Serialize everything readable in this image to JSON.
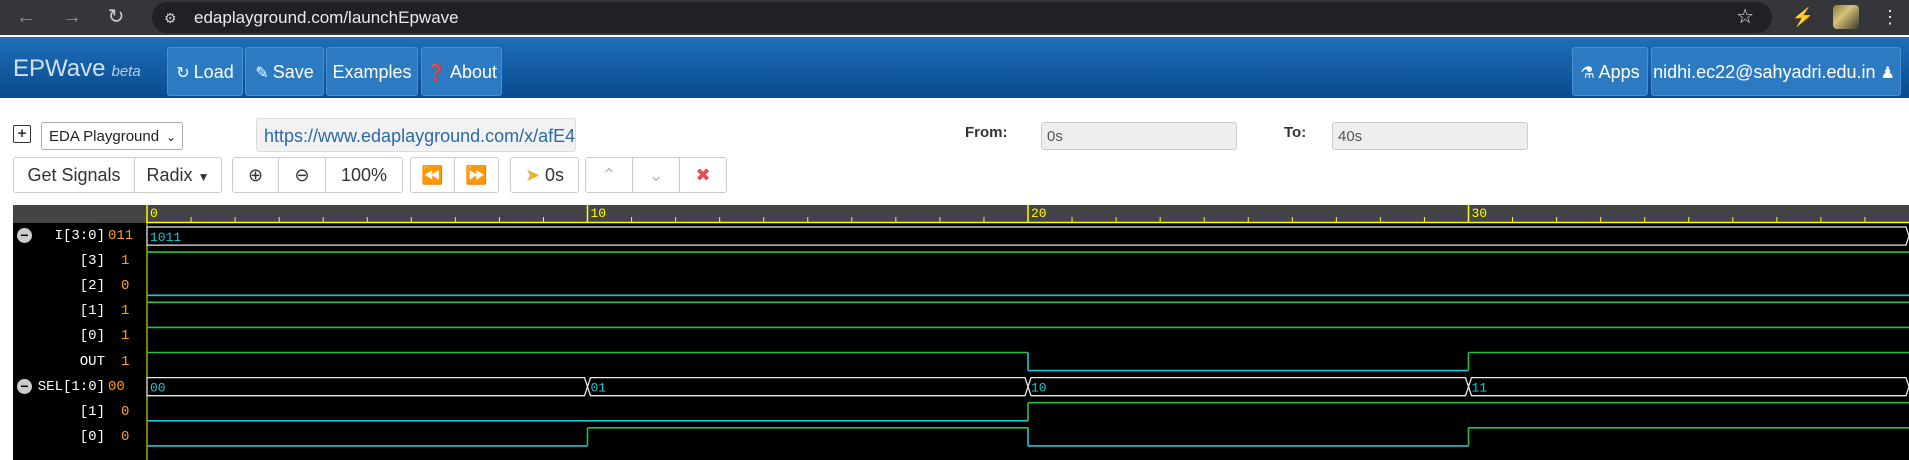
{
  "browser": {
    "url": "edaplayground.com/launchEpwave",
    "back_icon": "arrow-left-icon",
    "forward_icon": "arrow-right-icon",
    "reload_icon": "reload-icon"
  },
  "navbar": {
    "brand": "EPWave",
    "brand_suffix": "beta",
    "load_label": "Load",
    "save_label": "Save",
    "examples_label": "Examples",
    "about_label": "About",
    "apps_label": "Apps",
    "user_label": "nidhi.ec22@sahyadri.edu.in"
  },
  "toolbar": {
    "source_selected": "EDA Playground",
    "share_url": "https://www.edaplayground.com/x/afE4",
    "from_label": "From:",
    "from_value": "0s",
    "to_label": "To:",
    "to_value": "40s",
    "get_signals_label": "Get Signals",
    "radix_label": "Radix",
    "zoom_label": "100%",
    "cursor_time": "0s"
  },
  "waveform": {
    "time_range": [
      0,
      40
    ],
    "major_ticks": [
      "0",
      "10",
      "20",
      "30"
    ],
    "signals": [
      {
        "name": "I[3:0]",
        "value": "011",
        "type": "bus",
        "collapsible": true,
        "segments": [
          {
            "from": 0,
            "to": 40,
            "label": "1011"
          }
        ]
      },
      {
        "name": "[3]",
        "value": "1",
        "type": "bit",
        "transitions": [
          [
            0,
            1
          ]
        ]
      },
      {
        "name": "[2]",
        "value": "0",
        "type": "bit",
        "transitions": [
          [
            0,
            0
          ]
        ]
      },
      {
        "name": "[1]",
        "value": "1",
        "type": "bit",
        "transitions": [
          [
            0,
            1
          ]
        ]
      },
      {
        "name": "[0]",
        "value": "1",
        "type": "bit",
        "transitions": [
          [
            0,
            1
          ]
        ]
      },
      {
        "name": "OUT",
        "value": "1",
        "type": "bit",
        "transitions": [
          [
            0,
            1
          ],
          [
            20,
            0
          ],
          [
            30,
            1
          ]
        ]
      },
      {
        "name": "SEL[1:0]",
        "value": "00",
        "type": "bus",
        "collapsible": true,
        "segments": [
          {
            "from": 0,
            "to": 10,
            "label": "00"
          },
          {
            "from": 10,
            "to": 20,
            "label": "01"
          },
          {
            "from": 20,
            "to": 30,
            "label": "10"
          },
          {
            "from": 30,
            "to": 40,
            "label": "11"
          }
        ]
      },
      {
        "name": "[1]",
        "value": "0",
        "type": "bit",
        "transitions": [
          [
            0,
            0
          ],
          [
            20,
            1
          ]
        ]
      },
      {
        "name": "[0]",
        "value": "0",
        "type": "bit",
        "transitions": [
          [
            0,
            0
          ],
          [
            10,
            1
          ],
          [
            20,
            0
          ],
          [
            30,
            1
          ]
        ]
      }
    ]
  },
  "colors": {
    "navbar": "#0a4a90",
    "high": "#27c241",
    "low": "#19c8d8",
    "bus_text": "#19c8d8",
    "value_text": "#ff9e1a",
    "ruler": "#ffff00"
  }
}
